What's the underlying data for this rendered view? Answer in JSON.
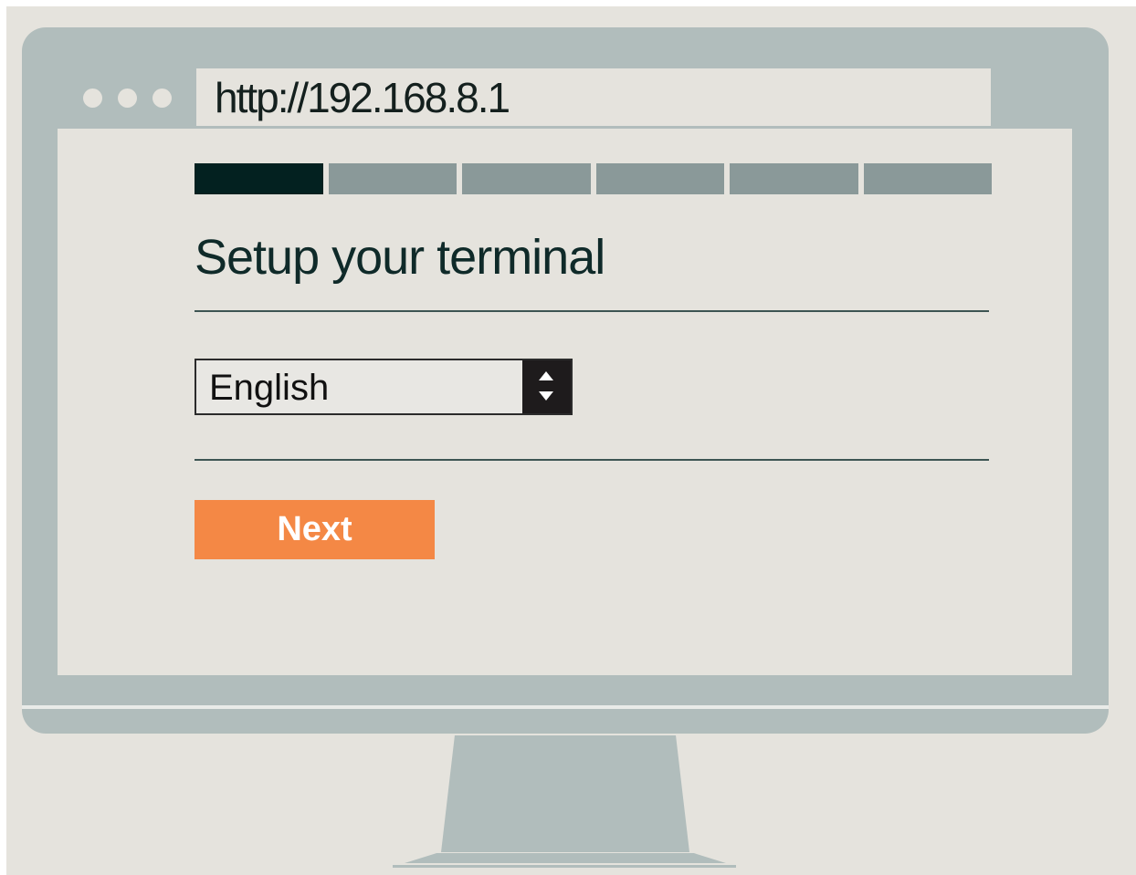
{
  "browser": {
    "url": "http://192.168.8.1",
    "window_controls": [
      "dot-icon",
      "dot-icon",
      "dot-icon"
    ]
  },
  "setup": {
    "progress": {
      "total_steps": 6,
      "current_step": 1
    },
    "title": "Setup your terminal",
    "language_select": {
      "selected": "English",
      "icon": "select-arrows-icon"
    },
    "next_label": "Next"
  },
  "colors": {
    "monitor": "#b1bdbc",
    "screen_background": "#e5e3dd",
    "progress_active": "#032120",
    "progress_inactive": "#8a9999",
    "accent_button": "#f48845",
    "text": "#0f2a29"
  }
}
